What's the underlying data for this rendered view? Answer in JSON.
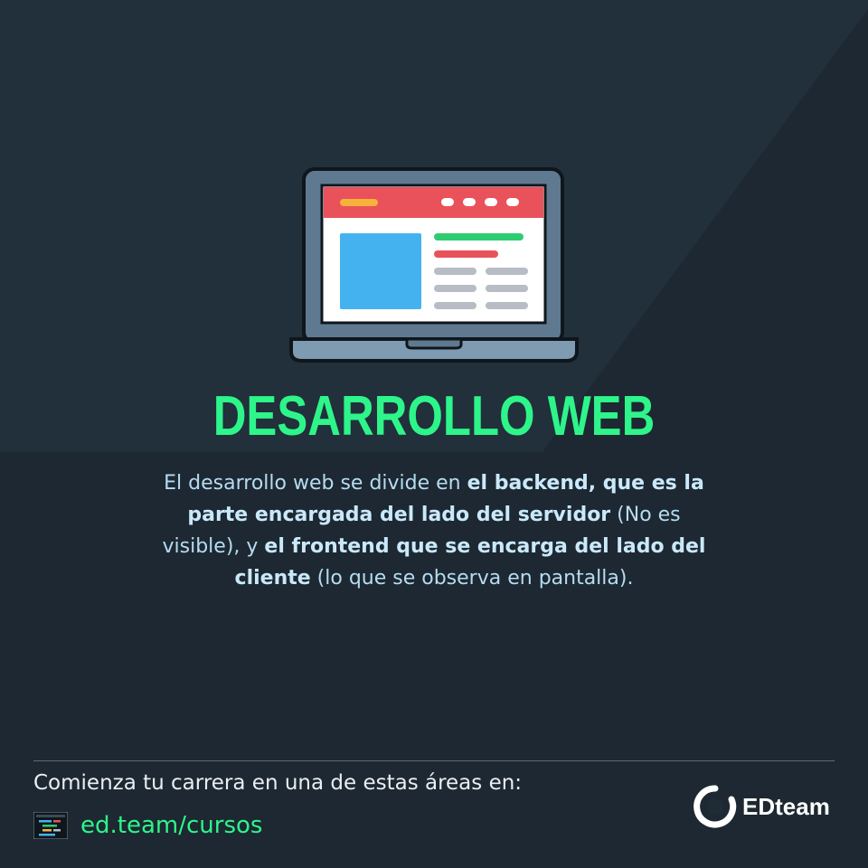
{
  "title": "DESARROLLO WEB",
  "description": [
    {
      "text": "El desarrollo web se divide en ",
      "bold": false
    },
    {
      "text": "el backend, que es la parte encargada del lado del servidor",
      "bold": true
    },
    {
      "text": " (No es visible), y ",
      "bold": false
    },
    {
      "text": "el frontend que se encarga del lado del cliente",
      "bold": true
    },
    {
      "text": " (lo que se observa en pantalla).",
      "bold": false
    }
  ],
  "footer": {
    "cta": "Comienza tu carrera en una de estas áreas en:",
    "link": "ed.team/cursos",
    "brand": "EDteam"
  },
  "icons": {
    "illustration": "laptop-webpage-icon",
    "link_icon": "code-editor-icon",
    "brand_logo": "edteam-logo-icon"
  },
  "colors": {
    "background": "#1f2b35",
    "accent": "#2ef58a",
    "text": "#b6dcf2"
  }
}
